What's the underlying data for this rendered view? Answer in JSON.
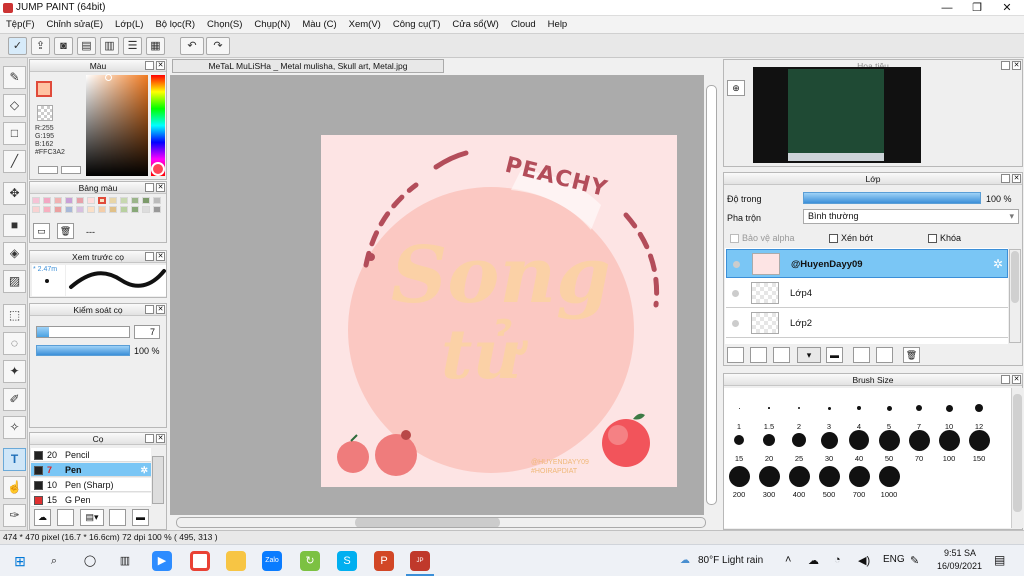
{
  "window": {
    "title": "JUMP PAINT (64bit)"
  },
  "menu": [
    "Tệp(F)",
    "Chỉnh sửa(E)",
    "Lớp(L)",
    "Bộ lọc(R)",
    "Chọn(S)",
    "Chụp(N)",
    "Màu (C)",
    "Xem(V)",
    "Công cụ(T)",
    "Cửa sổ(W)",
    "Cloud",
    "Help"
  ],
  "color_panel": {
    "title": "Màu",
    "r": "R:255",
    "g": "G:195",
    "b": "B:162",
    "hex": "#FFC3A2"
  },
  "swatch_panel": {
    "title": "Bảng màu",
    "dash": "---"
  },
  "brush_preview": {
    "title": "Xem trước cọ",
    "size": "* 2.47m"
  },
  "brush_control": {
    "title": "Kiểm soát cọ",
    "size_value": "7",
    "opacity": "100 %"
  },
  "brushes": {
    "title": "Cọ",
    "items": [
      {
        "size": "20",
        "name": "Pencil",
        "color": "#222222"
      },
      {
        "size": "7",
        "name": "Pen",
        "color": "#222222"
      },
      {
        "size": "10",
        "name": "Pen (Sharp)",
        "color": "#222222"
      },
      {
        "size": "15",
        "name": "G Pen",
        "color": "#e03030"
      }
    ]
  },
  "document": {
    "tab": "MeTaL MuLiSHa _ Metal mulisha, Skull art, Metal.jpg"
  },
  "artwork": {
    "peachy": "PEACHY",
    "song": "Song",
    "tu": "tử",
    "handle1": "@HUYENDAYY09",
    "handle2": "#HOIRAPDIAT"
  },
  "navigator": {
    "title": "Hoa tiêu"
  },
  "layer_panel": {
    "title": "Lớp",
    "opacity_label": "Độ trong",
    "opacity_value": "100 %",
    "blend_label": "Pha trộn",
    "blend_value": "Bình thường",
    "protect_alpha": "Bảo vệ alpha",
    "clip": "Xén bớt",
    "lock": "Khóa",
    "layers": [
      "@HuyenDayy09",
      "Lớp4",
      "Lớp2"
    ]
  },
  "brush_size": {
    "title": "Brush Size",
    "sizes": [
      "1",
      "1.5",
      "2",
      "3",
      "4",
      "5",
      "7",
      "10",
      "12",
      "15",
      "20",
      "25",
      "30",
      "40",
      "50",
      "70",
      "100",
      "150",
      "200",
      "300",
      "400",
      "500",
      "700",
      "1000"
    ]
  },
  "status": {
    "text": "474 * 470 pixel   (16.7 * 16.6cm)   72 dpi   100 %   ( 495, 313 )"
  },
  "taskbar": {
    "weather": "80°F  Light rain",
    "lang": "ENG",
    "time": "9:51 SA",
    "date": "16/09/2021"
  },
  "colors": {
    "accent": "#3b8fd8",
    "selection": "#7ac6f5",
    "peach": "#fbc4b4",
    "rose": "#b34d5a"
  }
}
